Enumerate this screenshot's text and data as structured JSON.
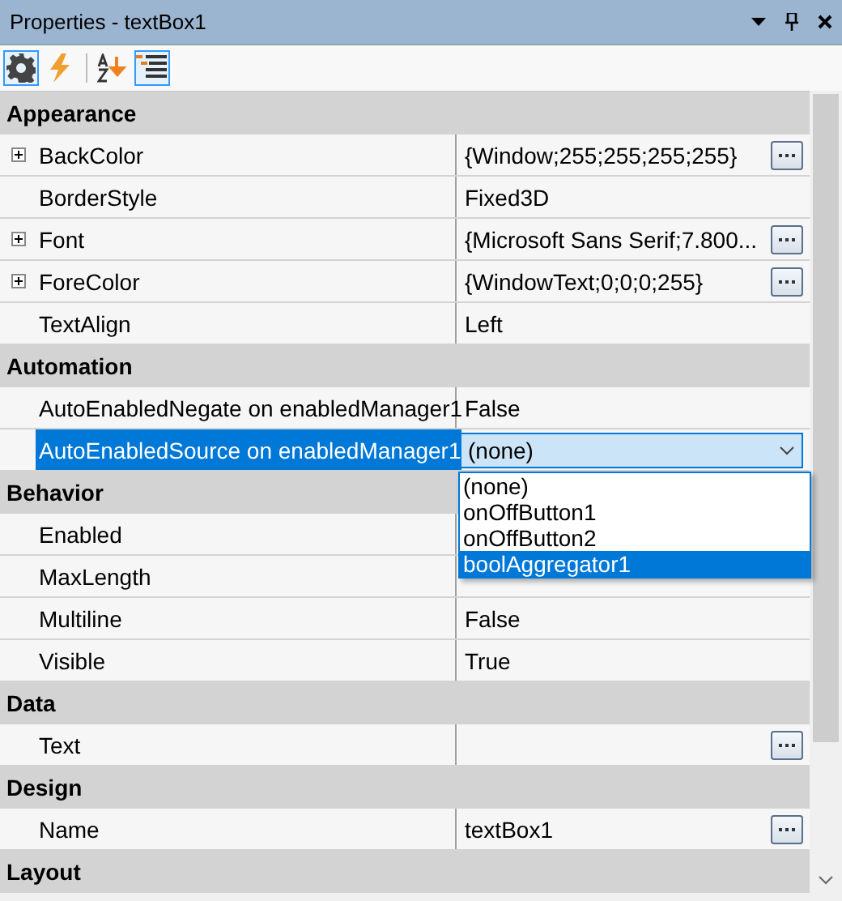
{
  "window": {
    "title": "Properties - textBox1"
  },
  "toolbar": [
    {
      "kind": "gear",
      "selected": true
    },
    {
      "kind": "bolt",
      "selected": false
    },
    {
      "kind": "sort",
      "selected": false
    },
    {
      "kind": "list",
      "selected": true
    }
  ],
  "categories": [
    {
      "name": "Appearance",
      "rows": [
        {
          "name": "BackColor",
          "value": "{Window;255;255;255;255}",
          "expandable": true,
          "has_button": true
        },
        {
          "name": "BorderStyle",
          "value": "Fixed3D",
          "expandable": false,
          "has_button": false
        },
        {
          "name": "Font",
          "value": "{Microsoft Sans Serif;7.800...",
          "expandable": true,
          "has_button": true
        },
        {
          "name": "ForeColor",
          "value": "{WindowText;0;0;0;255}",
          "expandable": true,
          "has_button": true
        },
        {
          "name": "TextAlign",
          "value": "Left",
          "expandable": false,
          "has_button": false
        }
      ]
    },
    {
      "name": "Automation",
      "rows": [
        {
          "name": "AutoEnabledNegate on enabledManager1",
          "value": "False",
          "expandable": false,
          "has_button": false
        },
        {
          "name": "AutoEnabledSource on enabledManager1",
          "value": "(none)",
          "expandable": false,
          "has_button": false,
          "selected": true,
          "dropdown": [
            {
              "label": "(none)",
              "highlighted": false
            },
            {
              "label": "onOffButton1",
              "highlighted": false
            },
            {
              "label": "onOffButton2",
              "highlighted": false
            },
            {
              "label": "boolAggregator1",
              "highlighted": true
            }
          ]
        }
      ]
    },
    {
      "name": "Behavior",
      "rows": [
        {
          "name": "Enabled",
          "expandable": false,
          "has_button": false
        },
        {
          "name": "MaxLength",
          "expandable": false,
          "has_button": false
        },
        {
          "name": "Multiline",
          "value": "False",
          "expandable": false,
          "has_button": false
        },
        {
          "name": "Visible",
          "value": "True",
          "expandable": false,
          "has_button": false
        }
      ]
    },
    {
      "name": "Data",
      "rows": [
        {
          "name": "Text",
          "expandable": false,
          "has_button": true
        }
      ]
    },
    {
      "name": "Design",
      "rows": [
        {
          "name": "Name",
          "value": "textBox1",
          "expandable": false,
          "has_button": true
        }
      ]
    },
    {
      "name": "Layout"
    }
  ]
}
